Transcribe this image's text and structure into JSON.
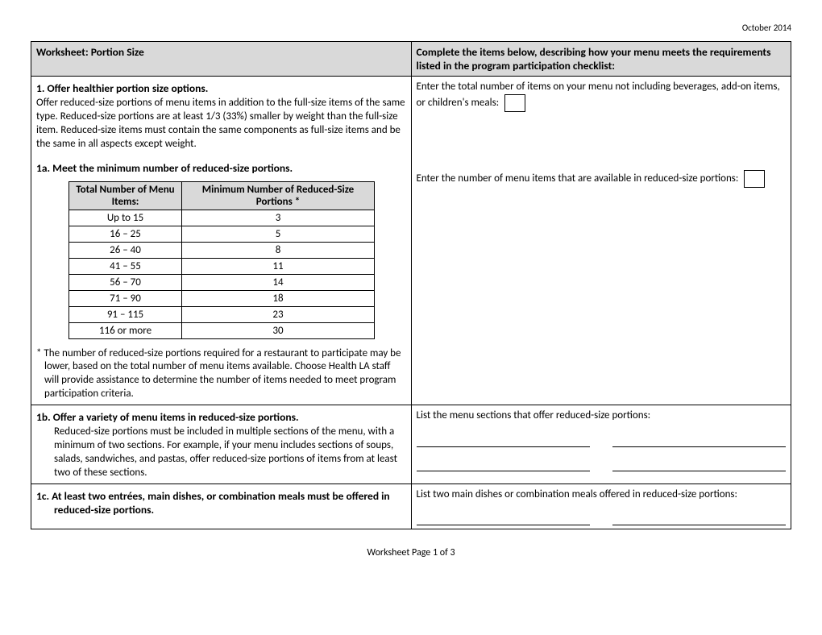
{
  "date": "October 2014",
  "header": {
    "left": "Worksheet: Portion Size",
    "right": "Complete the items below, describing how your menu meets the requirements listed in the program participation checklist:"
  },
  "s1": {
    "title": "1.   Offer healthier portion size options.",
    "body": "Offer reduced-size portions of menu items in addition to the full-size items of the same type. Reduced-size portions are at least 1/3 (33%) smaller by weight than the full-size item. Reduced-size items must contain the same components as full-size items and be the same in all aspects except weight.",
    "right": "Enter the total number of items on your menu not including beverages, add-on items, or children's meals:"
  },
  "s1a": {
    "title": "1a. Meet the minimum number of reduced-size portions.",
    "table_h1": "Total Number of Menu Items:",
    "table_h2": "Minimum Number of Reduced-Size Portions *",
    "rows": [
      {
        "a": "Up to 15",
        "b": "3"
      },
      {
        "a": "16 – 25",
        "b": "5"
      },
      {
        "a": "26 – 40",
        "b": "8"
      },
      {
        "a": "41 – 55",
        "b": "11"
      },
      {
        "a": "56 – 70",
        "b": "14"
      },
      {
        "a": "71 – 90",
        "b": "18"
      },
      {
        "a": "91 – 115",
        "b": "23"
      },
      {
        "a": "116 or more",
        "b": "30"
      }
    ],
    "footnote": "* The number of reduced-size portions required for a restaurant to participate may be lower, based on the total number of menu items available. Choose Health LA staff will provide assistance to determine the number of items needed to meet program participation criteria.",
    "right": "Enter the number of  menu items that are available in reduced-size portions:"
  },
  "s1b": {
    "title": "1b. Offer a variety of menu items in reduced-size portions.",
    "body": "Reduced-size portions must be included in multiple sections of the menu, with a minimum of two sections. For example, if your menu includes sections of soups, salads, sandwiches, and pastas, offer reduced-size portions of items from at least two of these sections.",
    "right": "List the menu sections that offer reduced-size portions:"
  },
  "s1c": {
    "title": "1c. At least two entrées, main dishes, or combination meals must be offered in reduced-size portions.",
    "right": "List two main dishes or combination meals offered in reduced-size portions:"
  },
  "footer": "Worksheet Page 1 of 3"
}
